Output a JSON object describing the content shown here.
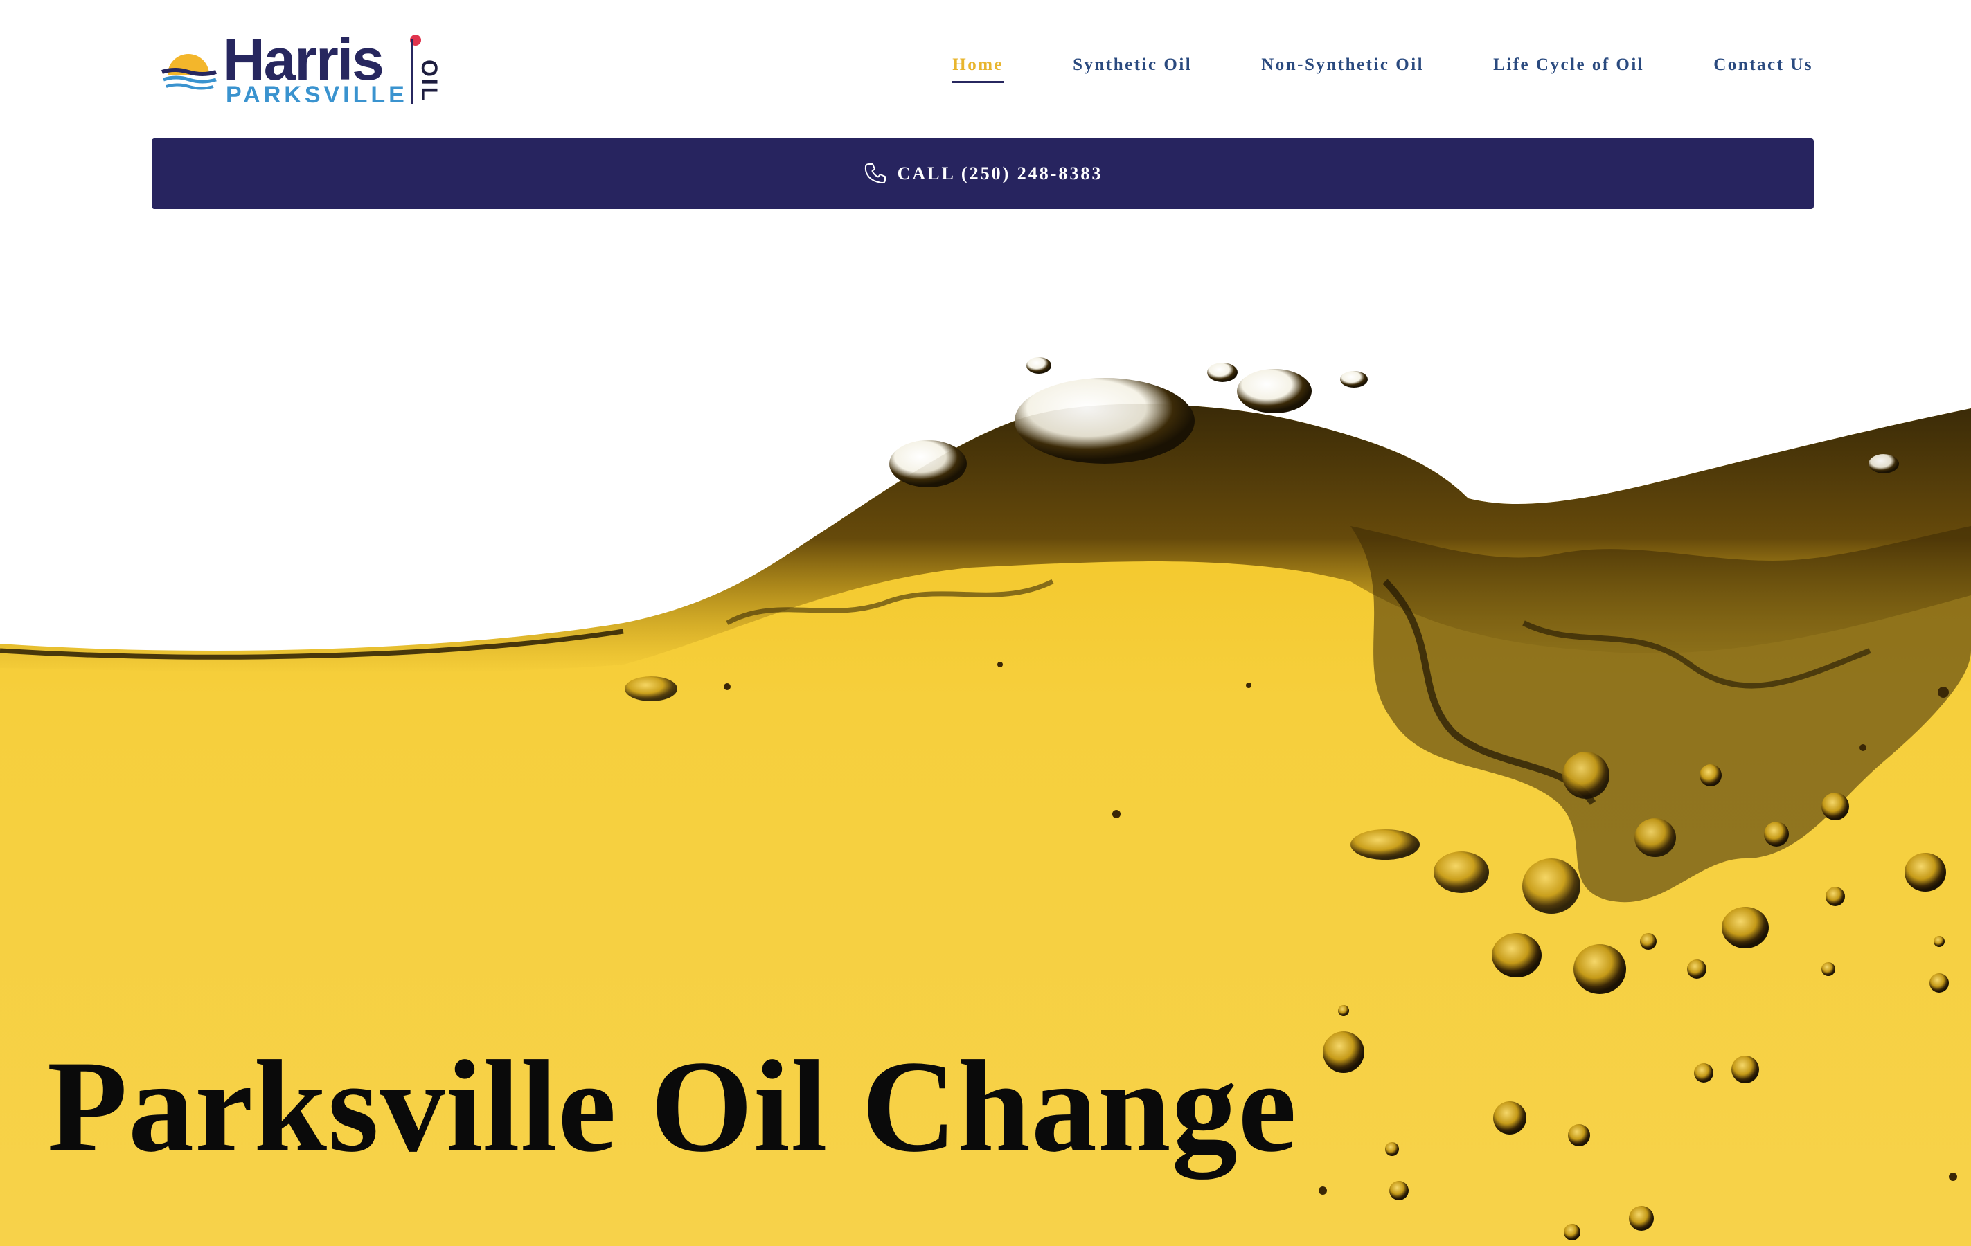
{
  "brand": {
    "name": "Harris",
    "location": "PARKSVILLE",
    "product": "OIL",
    "colors": {
      "navy": "#27275f",
      "blue": "#3a93cf",
      "red_dot": "#e0334d",
      "sun": "#f3b62b"
    }
  },
  "nav": {
    "items": [
      {
        "label": "Home",
        "active": true
      },
      {
        "label": "Synthetic Oil",
        "active": false
      },
      {
        "label": "Non-Synthetic Oil",
        "active": false
      },
      {
        "label": "Life Cycle of Oil",
        "active": false
      },
      {
        "label": "Contact Us",
        "active": false
      }
    ],
    "active_color": "#e8b52e",
    "color": "#2a4a7f"
  },
  "call_bar": {
    "label": "CALL (250) 248-8383",
    "icon": "phone-icon",
    "background": "#27245f"
  },
  "hero": {
    "title": "Parksville Oil Change",
    "image": "golden-oil-splash-with-bubbles",
    "oil_color": "#f6cf3c"
  }
}
